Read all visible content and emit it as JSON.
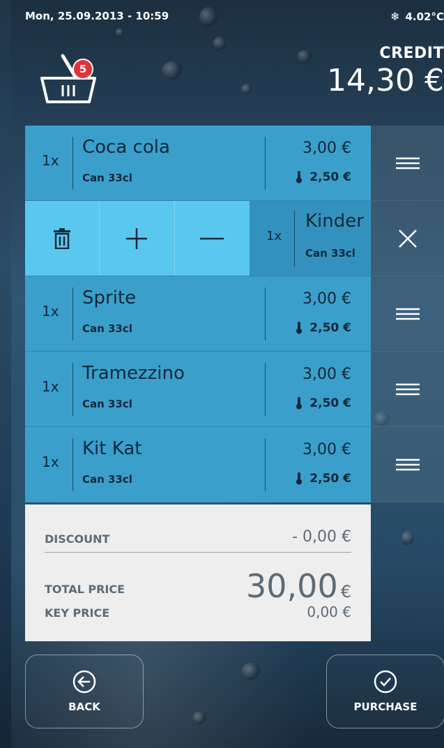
{
  "status": {
    "datetime": "Mon, 25.09.2013 - 10:59",
    "temperature": "4.02°C",
    "temperature_icon": "snowflake-icon"
  },
  "credit": {
    "label": "CREDIT",
    "value": "14,30 €"
  },
  "cart": {
    "badge_count": "5",
    "icon": "basket-icon"
  },
  "items": [
    {
      "qty": "1x",
      "name": "Coca cola",
      "sub": "Can 33cl",
      "price": "3,00 €",
      "cold_price": "2,50 €"
    },
    {
      "qty": "1x",
      "name": "Kinder",
      "sub": "Can 33cl",
      "editing": true
    },
    {
      "qty": "1x",
      "name": "Sprite",
      "sub": "Can 33cl",
      "price": "3,00 €",
      "cold_price": "2,50 €"
    },
    {
      "qty": "1x",
      "name": "Tramezzino",
      "sub": "Can 33cl",
      "price": "3,00 €",
      "cold_price": "2,50 €"
    },
    {
      "qty": "1x",
      "name": "Kit Kat",
      "sub": "Can 33cl",
      "price": "3,00 €",
      "cold_price": "2,50 €"
    }
  ],
  "edit_actions": [
    "trash-icon",
    "plus-icon",
    "minus-icon"
  ],
  "summary": {
    "discount_label": "DISCOUNT",
    "discount_value": "- 0,00 €",
    "total_label": "TOTAL PRICE",
    "total_value": "30,00",
    "total_currency": "€",
    "key_label": "KEY PRICE",
    "key_value": "0,00 €"
  },
  "buttons": {
    "back": "BACK",
    "purchase": "PURCHASE"
  },
  "colors": {
    "row": "#3b9fcb",
    "row_edit": "#5ac8ee",
    "badge": "#e03238",
    "summary_bg": "#eeeeee"
  }
}
